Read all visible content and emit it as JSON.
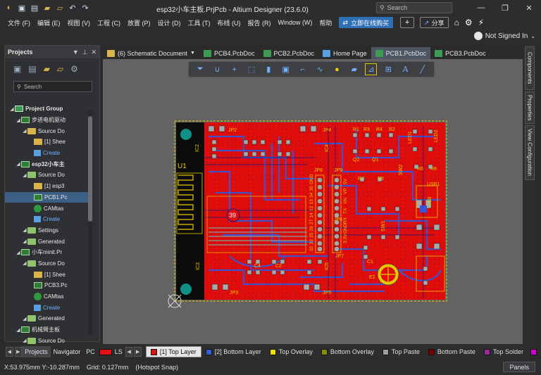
{
  "window": {
    "title": "esp32小车主板.PrjPcb - Altium Designer (23.6.0)",
    "search_placeholder": "Search"
  },
  "menu": {
    "items": [
      "文件 (F)",
      "编辑 (E)",
      "视图 (V)",
      "工程 (C)",
      "放置 (P)",
      "设计 (D)",
      "工具 (T)",
      "布线 (U)",
      "报告 (R)",
      "Window (W)",
      "帮助"
    ],
    "buy_label": "立即在线购买",
    "share_label": "分享"
  },
  "account": {
    "label": "Not Signed In"
  },
  "projects_panel": {
    "title": "Projects",
    "search_placeholder": "Search",
    "tree": [
      {
        "label": "Project Group",
        "depth": 0,
        "icon": "proj",
        "bold": true
      },
      {
        "label": "步进电机驱动",
        "depth": 1,
        "icon": "pcb",
        "expanded": true
      },
      {
        "label": "Source Do",
        "depth": 2,
        "icon": "folder"
      },
      {
        "label": "[1] Shee",
        "depth": 3,
        "icon": "folder"
      },
      {
        "label": "Create",
        "depth": 3,
        "icon": "create",
        "link": true
      },
      {
        "label": "esp32小车主",
        "depth": 1,
        "icon": "pcb",
        "bold": true
      },
      {
        "label": "Source Do",
        "depth": 2,
        "icon": "folder-g"
      },
      {
        "label": "[1] esp3",
        "depth": 3,
        "icon": "folder"
      },
      {
        "label": "PCB1.Pc",
        "depth": 3,
        "icon": "pcb",
        "selected": true
      },
      {
        "label": "CAMtas",
        "depth": 3,
        "icon": "cam"
      },
      {
        "label": "Create",
        "depth": 3,
        "icon": "create",
        "link": true
      },
      {
        "label": "Settings",
        "depth": 2,
        "icon": "folder-g"
      },
      {
        "label": "Generated",
        "depth": 2,
        "icon": "folder-g"
      },
      {
        "label": "小车minit.Pr",
        "depth": 1,
        "icon": "pcb"
      },
      {
        "label": "Source Do",
        "depth": 2,
        "icon": "folder-g"
      },
      {
        "label": "[1] Shee",
        "depth": 3,
        "icon": "folder"
      },
      {
        "label": "PCB3.Pc",
        "depth": 3,
        "icon": "pcb"
      },
      {
        "label": "CAMtas",
        "depth": 3,
        "icon": "cam"
      },
      {
        "label": "Create",
        "depth": 3,
        "icon": "create",
        "link": true
      },
      {
        "label": "Generated",
        "depth": 2,
        "icon": "folder-g"
      },
      {
        "label": "机械臂主板",
        "depth": 1,
        "icon": "pcb"
      },
      {
        "label": "Source Do",
        "depth": 2,
        "icon": "folder-g"
      }
    ]
  },
  "doc_tabs": [
    {
      "label": "(6) Schematic Document",
      "color": "#d9b44a",
      "active": false,
      "dropdown": true
    },
    {
      "label": "PCB4.PcbDoc",
      "color": "#3c9a54",
      "active": false
    },
    {
      "label": "PCB2.PcbDoc",
      "color": "#3c9a54",
      "active": false
    },
    {
      "label": "Home Page",
      "color": "#5aa0e0",
      "active": false
    },
    {
      "label": "PCB1.PcbDoc",
      "color": "#3c9a54",
      "active": true
    },
    {
      "label": "PCB3.PcbDoc",
      "color": "#3c9a54",
      "active": false
    }
  ],
  "right_panels": [
    "Components",
    "Properties",
    "View Configuration"
  ],
  "bottom": {
    "panel_tabs": [
      "Projects",
      "Navigator",
      "PC"
    ],
    "ls_label": "LS",
    "layers": [
      {
        "label": "[1] Top Layer",
        "color": "#e01010",
        "active": true
      },
      {
        "label": "[2] Bottom Layer",
        "color": "#2f5fd0",
        "active": false
      },
      {
        "label": "Top Overlay",
        "color": "#f0e000",
        "active": false
      },
      {
        "label": "Bottom Overlay",
        "color": "#8a8a10",
        "active": false
      },
      {
        "label": "Top Paste",
        "color": "#9e9e9e",
        "active": false
      },
      {
        "label": "Bottom Paste",
        "color": "#7a0000",
        "active": false
      },
      {
        "label": "Top Solder",
        "color": "#9c2a9c",
        "active": false
      }
    ]
  },
  "status": {
    "coords": "X:53.975mm Y:-10.287mm",
    "grid": "Grid: 0.127mm",
    "snap": "(Hotspot Snap)",
    "panels_label": "Panels"
  },
  "pcb": {
    "designators": [
      "U1",
      "IC2",
      "IC4",
      "IC3",
      "IC5",
      "JP2",
      "JP3",
      "JP4",
      "JP5",
      "JP6",
      "JP7",
      "JP8",
      "JP9",
      "R1",
      "R2",
      "R3",
      "R4",
      "R5",
      "R6",
      "R7",
      "R8",
      "Q1",
      "Q2",
      "C1",
      "C2",
      "C4",
      "E2",
      "SW1",
      "SW2",
      "LED1",
      "LED2",
      "USB1",
      "USB"
    ],
    "header_pins": [
      "GND",
      "35",
      "34",
      "13",
      "12",
      "14",
      "27",
      "26",
      "25",
      "33",
      "32"
    ],
    "right_header_pins": [
      "5V",
      "VP",
      "VN",
      "TX",
      "RX",
      "GND",
      "3.3V"
    ],
    "marker": "39"
  }
}
